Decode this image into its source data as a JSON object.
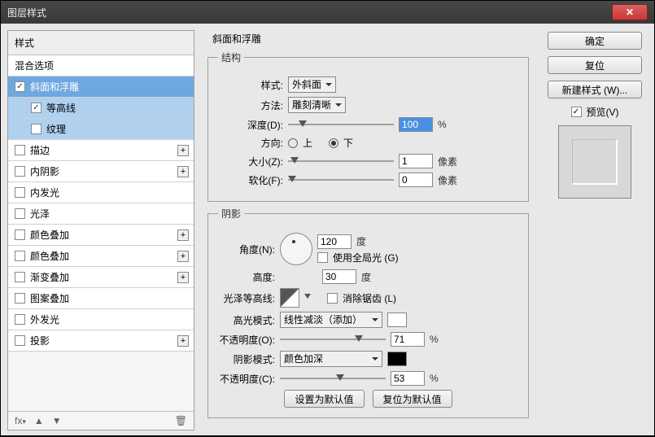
{
  "title": "图层样式",
  "left": {
    "head": "样式",
    "blend": "混合选项",
    "items": [
      {
        "label": "斜面和浮雕",
        "checked": true,
        "sel": true
      },
      {
        "label": "等高线",
        "checked": true,
        "sub": true,
        "sellight": true
      },
      {
        "label": "纹理",
        "checked": false,
        "sub": true,
        "sellight": true
      },
      {
        "label": "描边",
        "checked": false,
        "plus": true
      },
      {
        "label": "内阴影",
        "checked": false,
        "plus": true
      },
      {
        "label": "内发光",
        "checked": false
      },
      {
        "label": "光泽",
        "checked": false
      },
      {
        "label": "颜色叠加",
        "checked": false,
        "plus": true
      },
      {
        "label": "颜色叠加",
        "checked": false,
        "plus": true
      },
      {
        "label": "渐变叠加",
        "checked": false,
        "plus": true
      },
      {
        "label": "图案叠加",
        "checked": false
      },
      {
        "label": "外发光",
        "checked": false
      },
      {
        "label": "投影",
        "checked": false,
        "plus": true
      }
    ]
  },
  "section": {
    "title": "斜面和浮雕"
  },
  "struct": {
    "legend": "结构",
    "styleLbl": "样式:",
    "styleVal": "外斜面",
    "methodLbl": "方法:",
    "methodVal": "雕刻清晰",
    "depthLbl": "深度(D):",
    "depthVal": "100",
    "pct": "%",
    "dirLbl": "方向:",
    "up": "上",
    "down": "下",
    "sizeLbl": "大小(Z):",
    "sizeVal": "1",
    "px": "像素",
    "softLbl": "软化(F):",
    "softVal": "0"
  },
  "shade": {
    "legend": "阴影",
    "angleLbl": "角度(N):",
    "angleVal": "120",
    "deg": "度",
    "globalLbl": "使用全局光 (G)",
    "altLbl": "高度:",
    "altVal": "30",
    "glossLbl": "光泽等高线:",
    "aaLbl": "消除锯齿 (L)",
    "hiLbl": "高光模式:",
    "hiVal": "线性减淡（添加）",
    "hiOpLbl": "不透明度(O):",
    "hiOpVal": "71",
    "shLbl": "阴影模式:",
    "shVal": "颜色加深",
    "shOpLbl": "不透明度(C):",
    "shOpVal": "53"
  },
  "bottom": {
    "setDef": "设置为默认值",
    "resetDef": "复位为默认值"
  },
  "right": {
    "ok": "确定",
    "cancel": "复位",
    "newStyle": "新建样式 (W)...",
    "preview": "预览(V)"
  }
}
